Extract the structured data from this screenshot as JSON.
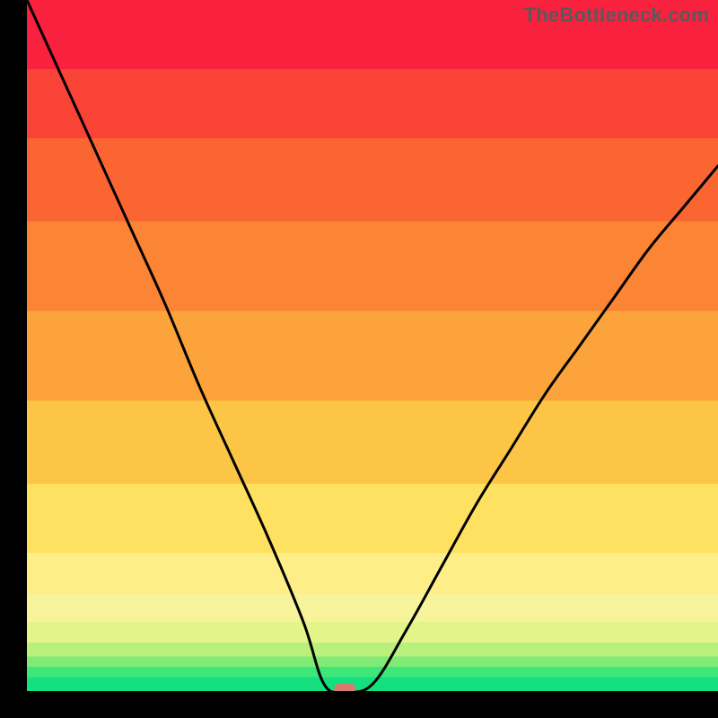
{
  "watermark": {
    "text": "TheBottleneck.com"
  },
  "chart_data": {
    "type": "line",
    "title": "",
    "xlabel": "",
    "ylabel": "",
    "xlim": [
      0,
      100
    ],
    "ylim": [
      0,
      100
    ],
    "x": [
      0,
      5,
      10,
      15,
      20,
      25,
      30,
      35,
      40,
      43,
      46,
      50,
      55,
      60,
      65,
      70,
      75,
      80,
      85,
      90,
      95,
      100
    ],
    "values": [
      100,
      89,
      78,
      67,
      56,
      44,
      33,
      22,
      10,
      1,
      0,
      1,
      9,
      18,
      27,
      35,
      43,
      50,
      57,
      64,
      70,
      76
    ],
    "marker": {
      "x": 46,
      "y": 0
    },
    "background_bands": [
      {
        "color": "#14e07f",
        "from": 0,
        "to": 2
      },
      {
        "color": "#3de77a",
        "from": 2,
        "to": 3.5
      },
      {
        "color": "#7feb76",
        "from": 3.5,
        "to": 5
      },
      {
        "color": "#b9f07c",
        "from": 5,
        "to": 7
      },
      {
        "color": "#e3f48a",
        "from": 7,
        "to": 10
      },
      {
        "color": "#f7f39a",
        "from": 10,
        "to": 14
      },
      {
        "color": "#fdee88",
        "from": 14,
        "to": 20
      },
      {
        "color": "#fee160",
        "from": 20,
        "to": 30
      },
      {
        "color": "#fdc546",
        "from": 30,
        "to": 42
      },
      {
        "color": "#fca43b",
        "from": 42,
        "to": 55
      },
      {
        "color": "#fb8534",
        "from": 55,
        "to": 68
      },
      {
        "color": "#fa6532",
        "from": 68,
        "to": 80
      },
      {
        "color": "#f94336",
        "from": 80,
        "to": 90
      },
      {
        "color": "#f8213e",
        "from": 90,
        "to": 100
      }
    ]
  }
}
